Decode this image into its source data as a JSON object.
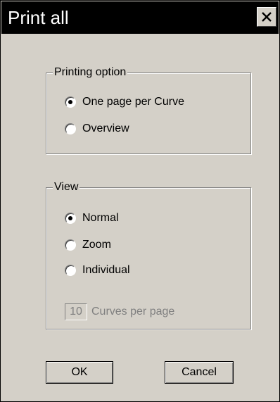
{
  "window": {
    "title": "Print all",
    "close_label": "close"
  },
  "printing_option": {
    "legend": "Printing option",
    "options": [
      {
        "label": "One page per Curve",
        "selected": true
      },
      {
        "label": "Overview",
        "selected": false
      }
    ]
  },
  "view": {
    "legend": "View",
    "options": [
      {
        "label": "Normal",
        "selected": true
      },
      {
        "label": "Zoom",
        "selected": false
      },
      {
        "label": "Individual",
        "selected": false
      }
    ],
    "curves_per_page_value": "10",
    "curves_per_page_label": "Curves per page",
    "curves_per_page_enabled": false
  },
  "buttons": {
    "ok_label": "OK",
    "cancel_label": "Cancel"
  },
  "icons": {
    "close": "close-icon",
    "radio_selected": "radio-selected-icon",
    "radio_unselected": "radio-unselected-icon"
  },
  "colors": {
    "titlebar_bg": "#000000",
    "titlebar_text": "#ffffff",
    "dialog_bg": "#d4d0c8",
    "disabled_text": "#808080"
  }
}
